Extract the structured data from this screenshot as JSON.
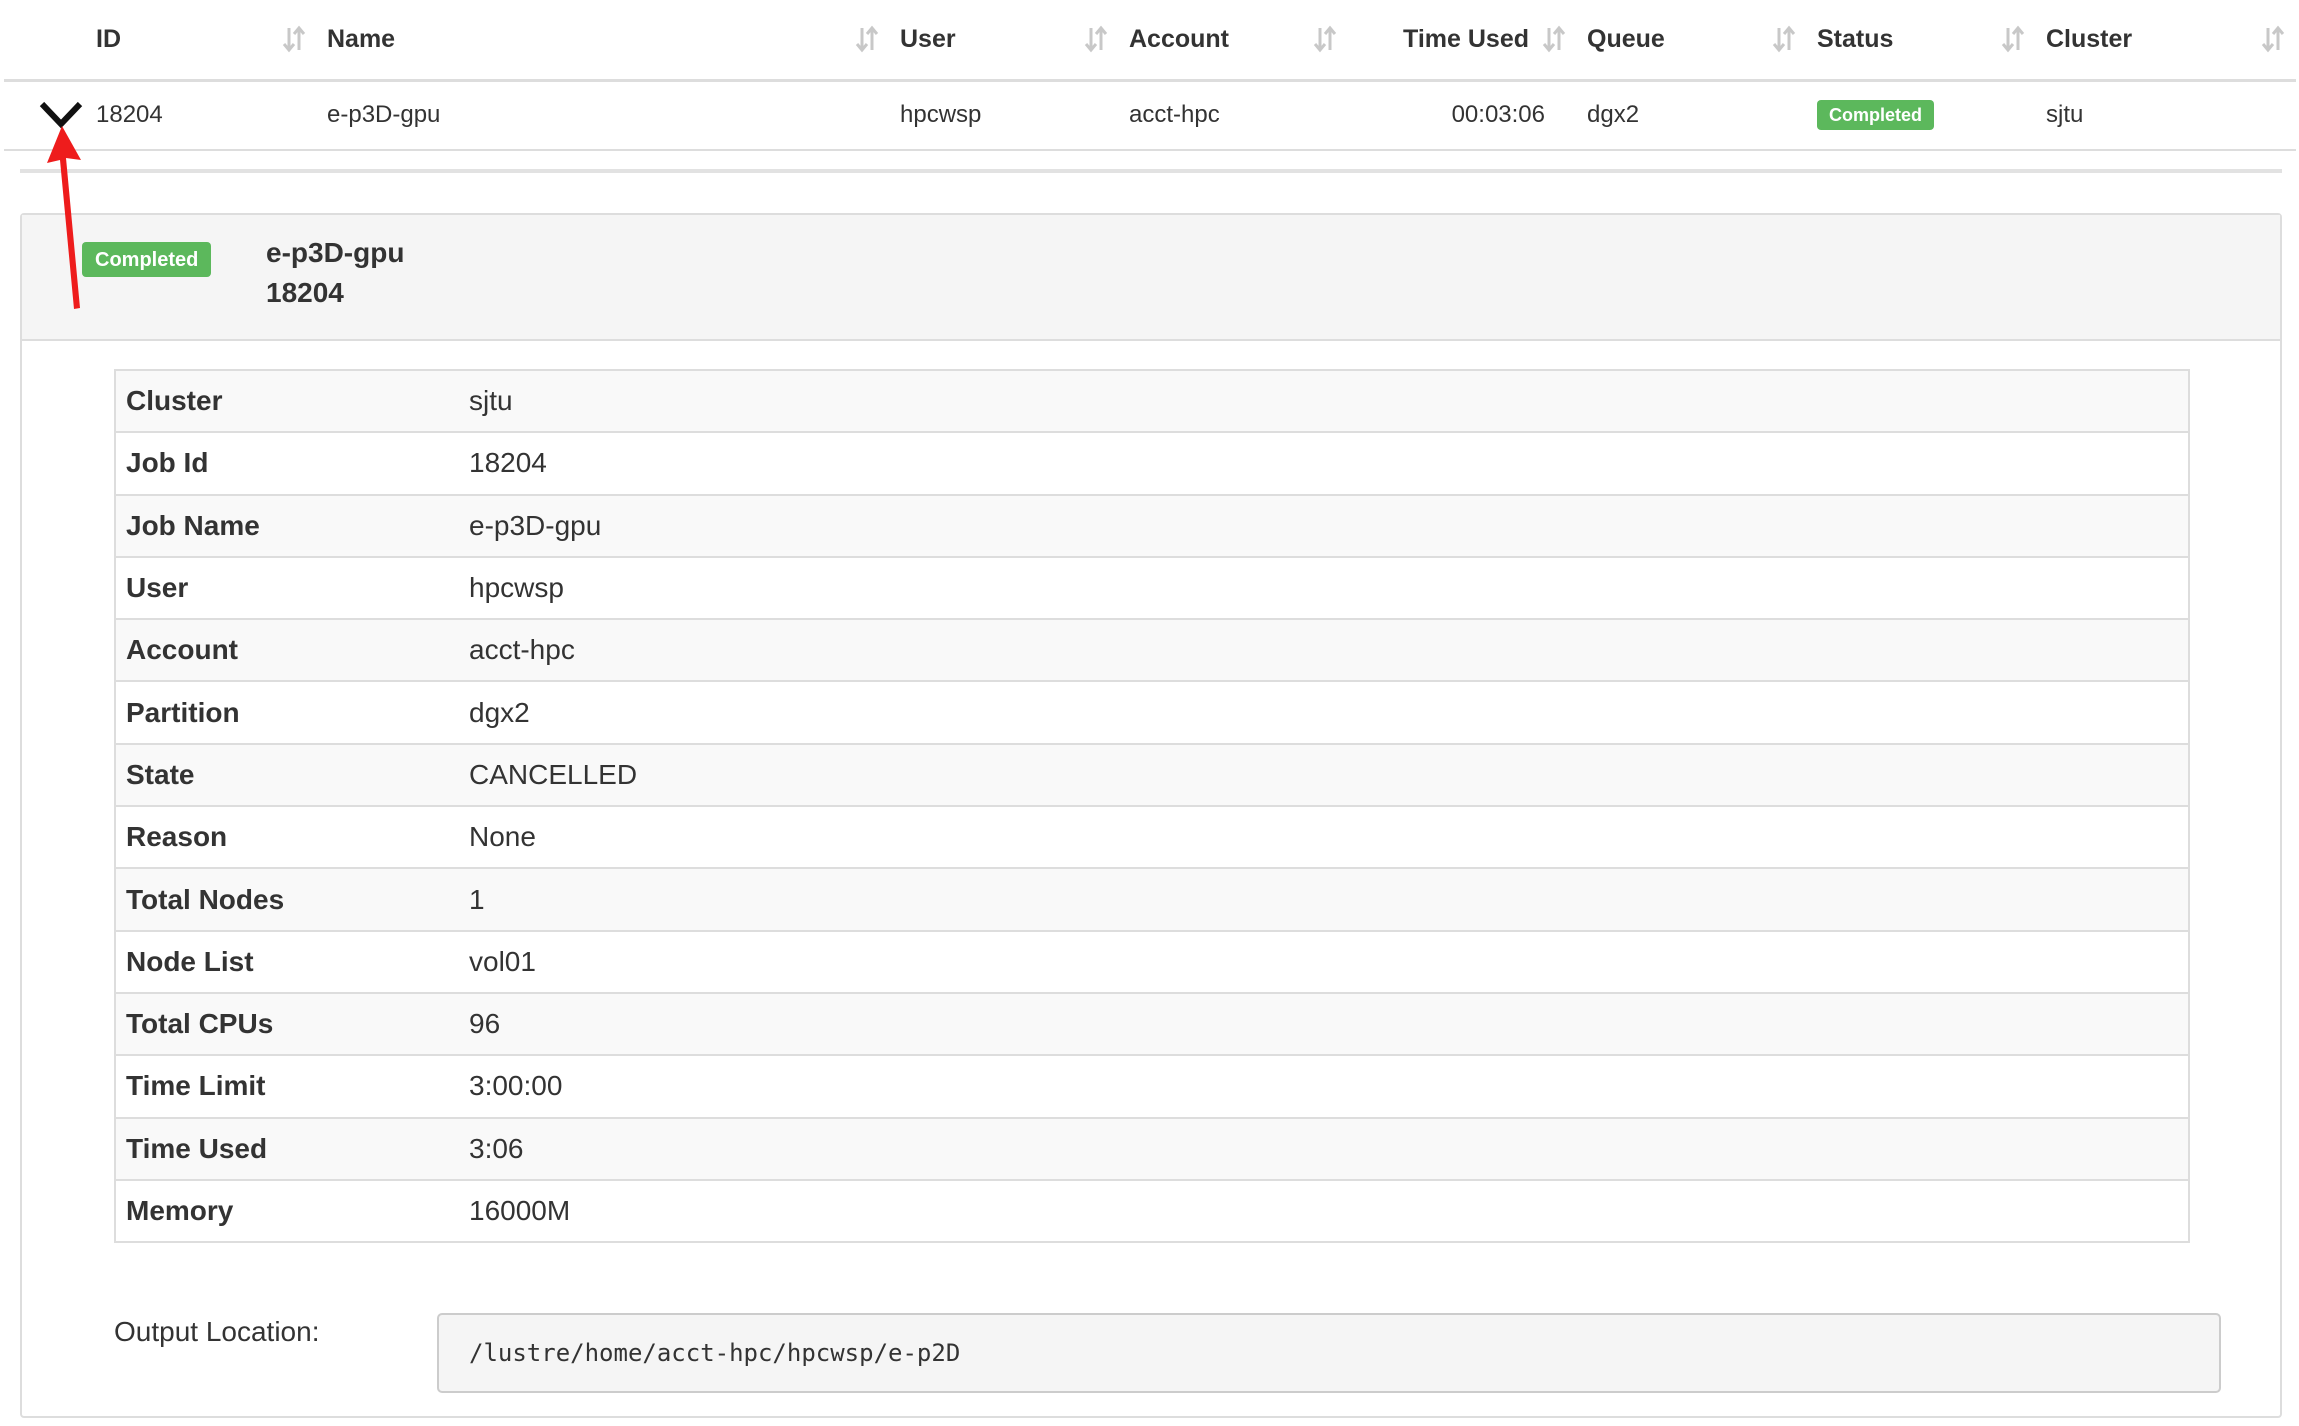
{
  "jobs_table": {
    "columns": [
      {
        "key": "id",
        "label": "ID"
      },
      {
        "key": "name",
        "label": "Name"
      },
      {
        "key": "user",
        "label": "User"
      },
      {
        "key": "account",
        "label": "Account"
      },
      {
        "key": "time_used",
        "label": "Time Used"
      },
      {
        "key": "queue",
        "label": "Queue"
      },
      {
        "key": "status",
        "label": "Status"
      },
      {
        "key": "cluster",
        "label": "Cluster"
      }
    ],
    "rows": [
      {
        "id": "18204",
        "name": "e-p3D-gpu",
        "user": "hpcwsp",
        "account": "acct-hpc",
        "time_used": "00:03:06",
        "queue": "dgx2",
        "status": "Completed",
        "cluster": "sjtu"
      }
    ],
    "expand_icon": "chevron-down-icon",
    "sort_icon": "sort-updown-icon"
  },
  "detail": {
    "status": "Completed",
    "job_name": "e-p3D-gpu",
    "job_id": "18204",
    "fields": [
      {
        "label": "Cluster",
        "value": "sjtu"
      },
      {
        "label": "Job Id",
        "value": "18204"
      },
      {
        "label": "Job Name",
        "value": "e-p3D-gpu"
      },
      {
        "label": "User",
        "value": "hpcwsp"
      },
      {
        "label": "Account",
        "value": "acct-hpc"
      },
      {
        "label": "Partition",
        "value": "dgx2"
      },
      {
        "label": "State",
        "value": "CANCELLED"
      },
      {
        "label": "Reason",
        "value": "None"
      },
      {
        "label": "Total Nodes",
        "value": "1"
      },
      {
        "label": "Node List",
        "value": "vol01"
      },
      {
        "label": "Total CPUs",
        "value": "96"
      },
      {
        "label": "Time Limit",
        "value": "3:00:00"
      },
      {
        "label": "Time Used",
        "value": "3:06"
      },
      {
        "label": "Memory",
        "value": "16000M"
      }
    ],
    "output_label": "Output Location:",
    "output_path": "/lustre/home/acct-hpc/hpcwsp/e-p2D"
  },
  "colors": {
    "status_success": "#5cb85c",
    "annotation_arrow": "#ee1c1c",
    "border": "#dddddd",
    "panel_heading_bg": "#f5f5f5"
  }
}
